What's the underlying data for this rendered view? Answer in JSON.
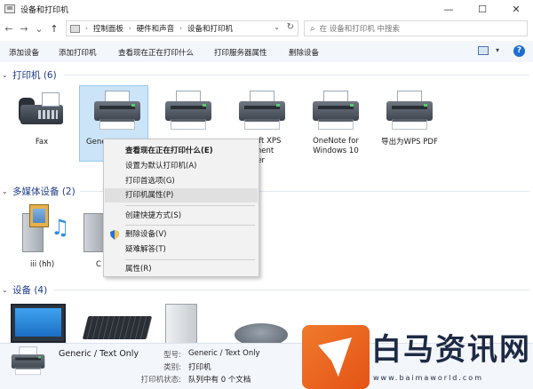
{
  "window": {
    "title": "设备和打印机",
    "minimize": "—",
    "maximize": "☐",
    "close": "✕"
  },
  "nav": {
    "back": "←",
    "forward": "→",
    "recent": "⌄",
    "up": "↑"
  },
  "address": {
    "crumbs": [
      "控制面板",
      "硬件和声音",
      "设备和打印机"
    ],
    "separator": "›",
    "dropdown": "⌄",
    "refresh": "↻"
  },
  "search": {
    "icon": "⌕",
    "placeholder": "在 设备和打印机 中搜索"
  },
  "toolbar": {
    "items": [
      "添加设备",
      "添加打印机",
      "查看现在正在打印什么",
      "打印服务器属性",
      "删除设备"
    ],
    "view_dropdown": "▾",
    "help": "?"
  },
  "groups": {
    "printers": "打印机 (6)",
    "multimedia": "多媒体设备 (2)",
    "devices": "设备 (4)",
    "chevron": "⌄"
  },
  "printers": [
    {
      "label": "Fax"
    },
    {
      "label": "Gene"
    },
    {
      "label": ""
    },
    {
      "label": "oft XPS\nment\nter"
    },
    {
      "label": "OneNote for\nWindows 10"
    },
    {
      "label": "导出为WPS PDF"
    }
  ],
  "media": [
    {
      "label": "iii (hh)"
    },
    {
      "label": "C"
    }
  ],
  "context_menu": {
    "items": [
      {
        "label": "查看现在正在打印什么(E)",
        "bold": true
      },
      {
        "label": "设置为默认打印机(A)"
      },
      {
        "label": "打印首选项(G)"
      },
      {
        "label": "打印机属性(P)",
        "hover": true
      },
      {
        "label": "创建快捷方式(S)"
      },
      {
        "label": "删除设备(V)"
      },
      {
        "label": "疑难解答(T)"
      },
      {
        "label": "属性(R)"
      }
    ]
  },
  "status": {
    "name": "Generic / Text Only",
    "model_key": "型号:",
    "model_val": "Generic / Text Only",
    "category_key": "类别:",
    "category_val": "打印机",
    "state_key": "打印机状态:",
    "state_val": "队列中有 0 个文档"
  },
  "watermark": {
    "text": "白马资讯网",
    "url": "www.baimaworld.com"
  }
}
